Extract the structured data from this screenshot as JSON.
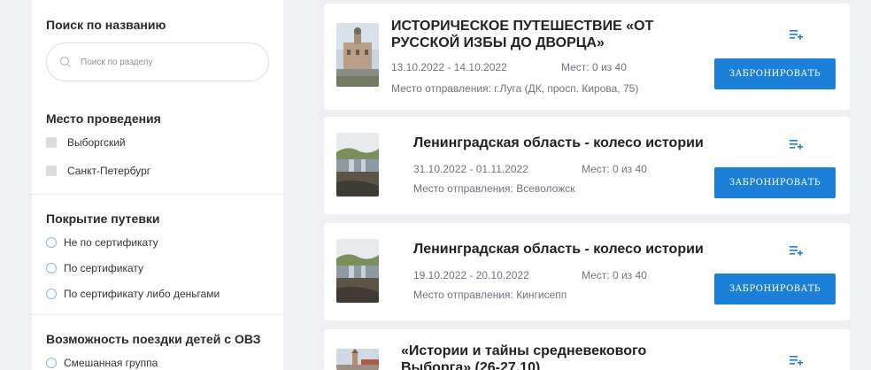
{
  "sidebar": {
    "search": {
      "title": "Поиск по названию",
      "placeholder": "Поиск по разделу"
    },
    "venue": {
      "title": "Место проведения",
      "options": [
        "Выборгский",
        "Санкт-Петербург"
      ]
    },
    "coverage": {
      "title": "Покрытие путевки",
      "options": [
        "Не по сертификату",
        "По сертификату",
        "По сертификату либо деньгами"
      ]
    },
    "ovz": {
      "title": "Возможность поездки детей с ОВЗ",
      "options": [
        "Смешанная группа"
      ]
    }
  },
  "cards": [
    {
      "title_line1": "ИСТОРИЧЕСКОЕ ПУТЕШЕСТВИЕ «ОТ",
      "title_line2": "РУССКОЙ ИЗБЫ ДО ДВОРЦА»",
      "dates": "13.10.2022 - 14.10.2022",
      "seats": "Мест: 0 из 40",
      "departure": "Место отправления: г.Луга (ДК, просп. Кирова, 75)",
      "button": "ЗАБРОНИРОВАТЬ",
      "thumb_icon": "palace-photo"
    },
    {
      "title_line1": "Ленинградская область - колесо истории",
      "dates": "31.10.2022 - 01.11.2022",
      "seats": "Мест: 0 из 40",
      "departure": "Место отправления: Всеволожск",
      "button": "ЗАБРОНИРОВАТЬ",
      "thumb_icon": "waterfall-photo"
    },
    {
      "title_line1": "Ленинградская область - колесо истории",
      "dates": "19.10.2022 - 20.10.2022",
      "seats": "Мест: 0 из 40",
      "departure": "Место отправления: Кингисепп",
      "button": "ЗАБРОНИРОВАТЬ",
      "thumb_icon": "waterfall-photo"
    },
    {
      "title_line1": "«Истории и тайны средневекового",
      "title_line2": "Выборга» (26-27.10)",
      "thumb_icon": "castle-photo"
    }
  ],
  "colors": {
    "accent": "#1c7fd8",
    "background": "#eef0f4"
  }
}
